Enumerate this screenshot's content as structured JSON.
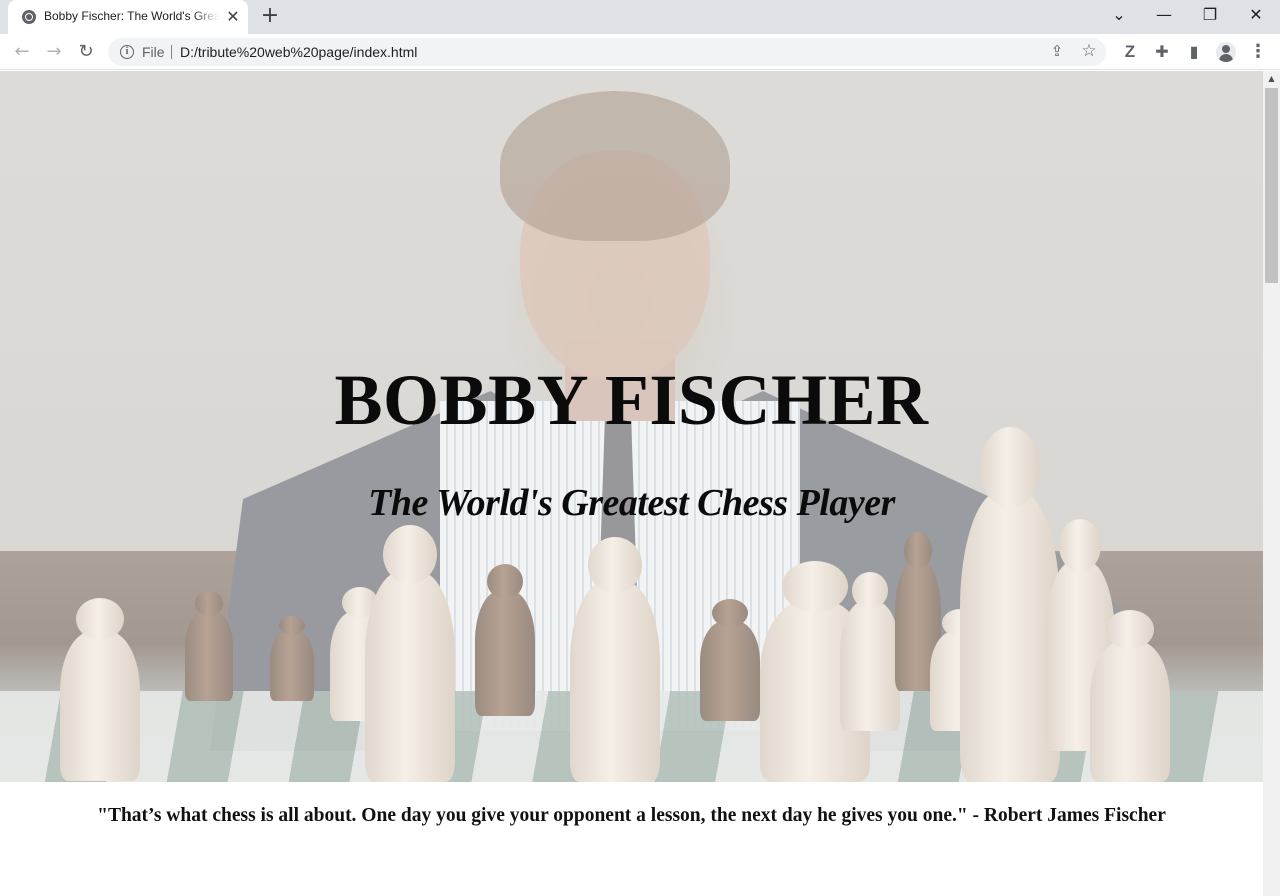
{
  "browser": {
    "tab": {
      "title": "Bobby Fischer: The World's Greatest Chess Player",
      "favicon_icon": "globe-icon",
      "close_glyph": "✕"
    },
    "new_tab_glyph": "+",
    "window_controls": {
      "tab_search_glyph": "⌄",
      "minimize_glyph": "—",
      "restore_glyph": "❐",
      "close_glyph": "✕"
    },
    "toolbar": {
      "back_glyph": "←",
      "forward_glyph": "→",
      "reload_glyph": "↻",
      "site_info_glyph": "i",
      "scheme_label": "File",
      "url": "D:/tribute%20web%20page/index.html",
      "share_glyph": "⇪",
      "bookmark_glyph": "☆",
      "extension_z_glyph": "Z",
      "extension_puzzle_glyph": "✚",
      "side_panel_glyph": "▮",
      "menu_glyph": "⋮"
    }
  },
  "page": {
    "hero": {
      "title": "BOBBY FISCHER",
      "subtitle": "The World's Greatest Chess Player"
    },
    "quote": "\"That’s what chess is all about. One day you give your opponent a lesson, the next day he gives you one.\" - Robert James Fischer"
  },
  "colors": {
    "tab_strip": "#dee1e6",
    "omnibox": "#f1f3f4",
    "heading_text": "#0b0b0b",
    "scroll_thumb": "#c1c1c1"
  }
}
